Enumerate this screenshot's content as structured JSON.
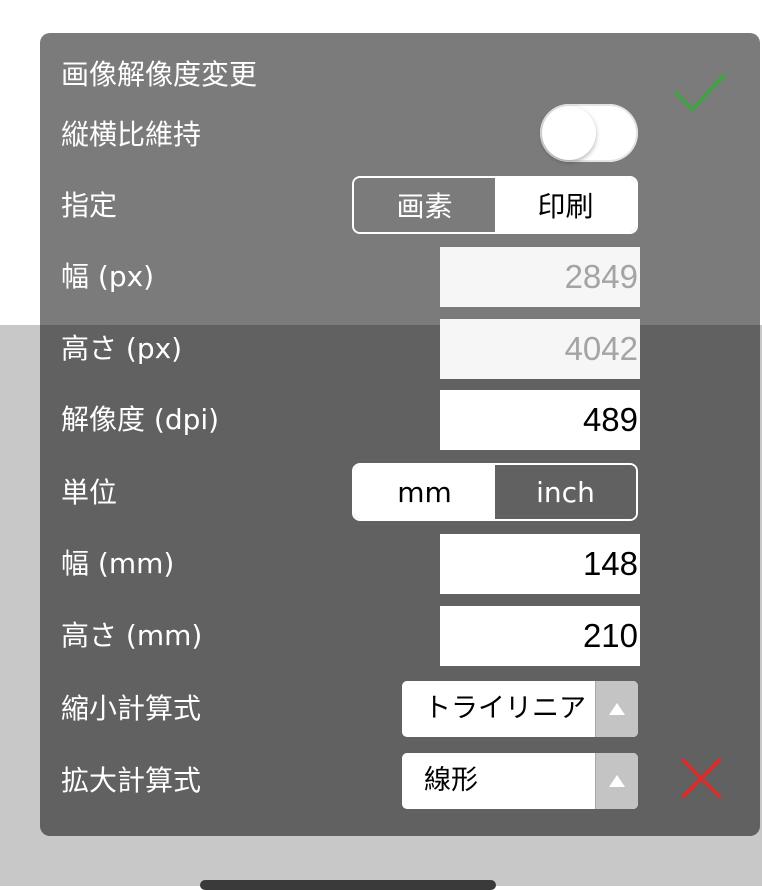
{
  "dialog": {
    "title": "画像解像度変更",
    "confirm_icon": "checkmark-icon",
    "cancel_icon": "close-icon",
    "accent_colors": {
      "confirm": "#43a047",
      "cancel": "#d32f2f"
    }
  },
  "aspect_ratio": {
    "label": "縦横比維持",
    "enabled": false
  },
  "specify": {
    "label": "指定",
    "options": [
      "画素",
      "印刷"
    ],
    "selected": "印刷"
  },
  "width_px": {
    "label": "幅 (px)",
    "value": "2849",
    "enabled": false
  },
  "height_px": {
    "label": "高さ (px)",
    "value": "4042",
    "enabled": false
  },
  "resolution": {
    "label": "解像度 (dpi)",
    "value": "489"
  },
  "unit": {
    "label": "単位",
    "options": [
      "mm",
      "inch"
    ],
    "selected": "mm"
  },
  "width_mm": {
    "label": "幅 (mm)",
    "value": "148"
  },
  "height_mm": {
    "label": "高さ (mm)",
    "value": "210"
  },
  "reduce_method": {
    "label": "縮小計算式",
    "value": "トライリニア",
    "arrow_icon": "triangle-up-icon"
  },
  "enlarge_method": {
    "label": "拡大計算式",
    "value": "線形",
    "arrow_icon": "triangle-up-icon"
  }
}
